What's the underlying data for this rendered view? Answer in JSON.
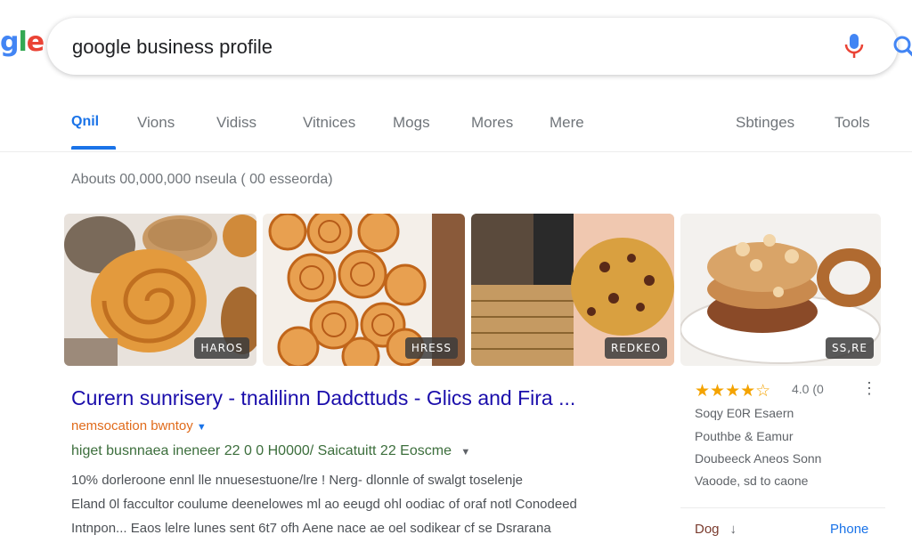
{
  "logo": {
    "visible_text": "gle"
  },
  "search": {
    "query": "google business profile"
  },
  "tabs": [
    {
      "label": "Qnil",
      "active": true
    },
    {
      "label": "Vions",
      "active": false
    },
    {
      "label": "Vidiss",
      "active": false
    },
    {
      "label": "Vitnices",
      "active": false
    },
    {
      "label": "Mogs",
      "active": false
    },
    {
      "label": "Mores",
      "active": false
    },
    {
      "label": "Mere",
      "active": false
    },
    {
      "label": "Sbtinges",
      "active": false
    },
    {
      "label": "Tools",
      "active": false
    }
  ],
  "result_stats": "Abouts  00,000,000 nseula ( 00 esseorda)",
  "images": [
    {
      "badge": "HAROS"
    },
    {
      "badge": "HRESS"
    },
    {
      "badge": "REDKEO"
    },
    {
      "badge": "SS,RE"
    }
  ],
  "result": {
    "title": "Curern sunrisery - tnalilinn Dadcttuds - Glics and Fira ...",
    "subline": "nemsocation  bwntoy",
    "url_line": "higet busnnaea ineneer  22 0 0 H0000/ Saicatuitt 22 Eoscme",
    "snippet": [
      "10% dorleroone ennl lle nnuesestuone/lre !  Nerg-   dlonnle of swalgt toselenje",
      "Eland 0l  faccultor  coulume  deenelowes ml ao eeugd ohl oodiac of oraf notl  Conodeed",
      "Intnpon...  Eaos lelre lunes sent 6t7 ofh Aene nace ae oel sodikear cf se Dsrarana"
    ]
  },
  "side_panel": {
    "stars": "★★★★☆",
    "rating": "4.0 (0",
    "lines": [
      "Soqy E0R Esaern",
      "Pouthbe & Eamur",
      "Doubeeck Aneos Sonn",
      "Vaoode, sd to caone"
    ],
    "footer_left": "Dog",
    "footer_right": "Phone"
  },
  "colors": {
    "link_title": "#1a0dab",
    "accent": "#1a73e8",
    "url_green": "#3c6e3c",
    "star_gold": "#f4a300"
  }
}
